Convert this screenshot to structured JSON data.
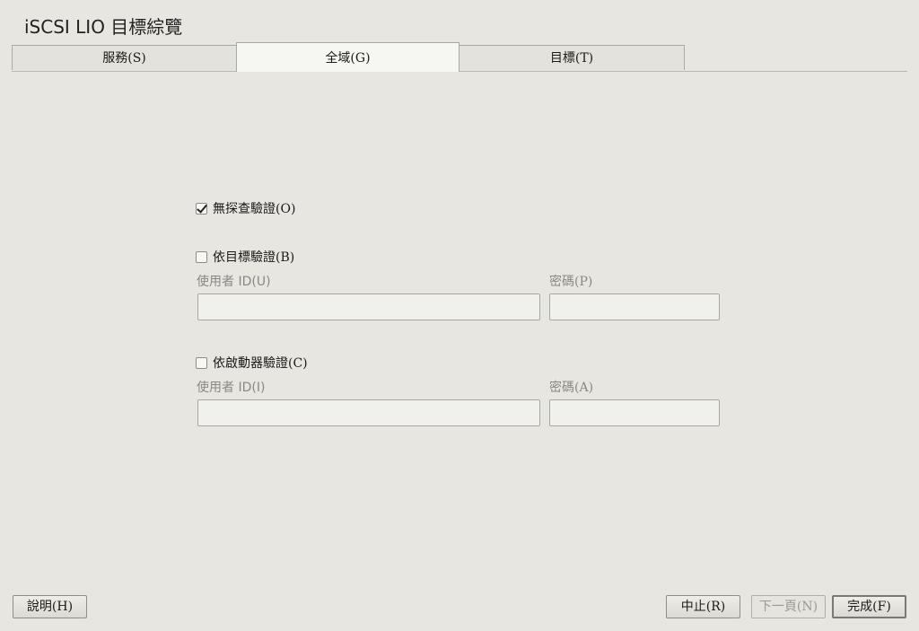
{
  "window": {
    "title": "iSCSI LIO 目標綜覽"
  },
  "tabs": [
    {
      "label": "服務(S)"
    },
    {
      "label": "全域(G)"
    },
    {
      "label": "目標(T)"
    }
  ],
  "discovery": {
    "no_auth_label": "無探查驗證(O)",
    "no_auth_checked": true,
    "by_targets": {
      "label": "依目標驗證(B)",
      "checked": false,
      "user_id_label": "使用者 ID(U)",
      "user_id_value": "",
      "password_label": "密碼(P)",
      "password_value": ""
    },
    "by_initiators": {
      "label": "依啟動器驗證(C)",
      "checked": false,
      "user_id_label": "使用者 ID(I)",
      "user_id_value": "",
      "password_label": "密碼(A)",
      "password_value": ""
    }
  },
  "footer": {
    "help_label": "說明(H)",
    "abort_label": "中止(R)",
    "next_label": "下一頁(N)",
    "finish_label": "完成(F)"
  }
}
